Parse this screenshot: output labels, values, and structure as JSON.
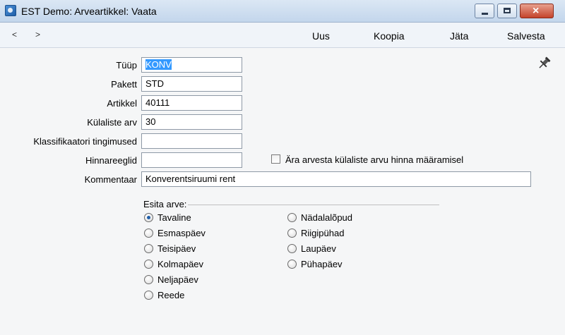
{
  "window": {
    "title": "EST Demo: Arveartikkel: Vaata"
  },
  "toolbar": {
    "back": "<",
    "forward": ">",
    "new": "Uus",
    "copy": "Koopia",
    "leave": "Jäta",
    "save": "Salvesta"
  },
  "form": {
    "type_label": "Tüüp",
    "type_value": "KONV",
    "package_label": "Pakett",
    "package_value": "STD",
    "item_label": "Artikkel",
    "item_value": "40111",
    "guests_label": "Külaliste arv",
    "guests_value": "30",
    "classifier_label": "Klassifikaatori tingimused",
    "classifier_value": "",
    "price_rules_label": "Hinnareeglid",
    "price_rules_value": "",
    "ignore_guests_label": "Ära arvesta külaliste arvu hinna määramisel",
    "ignore_guests_checked": false,
    "comment_label": "Kommentaar",
    "comment_value": "Konverentsiruumi rent"
  },
  "invoice_group": {
    "label": "Esita arve:",
    "selected": "Tavaline",
    "left": [
      "Tavaline",
      "Esmaspäev",
      "Teisipäev",
      "Kolmapäev",
      "Neljapäev",
      "Reede"
    ],
    "right": [
      "Nädalalõpud",
      "Riigipühad",
      "Laupäev",
      "Pühapäev"
    ]
  },
  "colors": {
    "selection": "#3399ff",
    "title_bar": "#c3d6ec",
    "close_button": "#c4432b"
  },
  "icons": {
    "app": "app-icon",
    "pin": "pin-icon"
  }
}
